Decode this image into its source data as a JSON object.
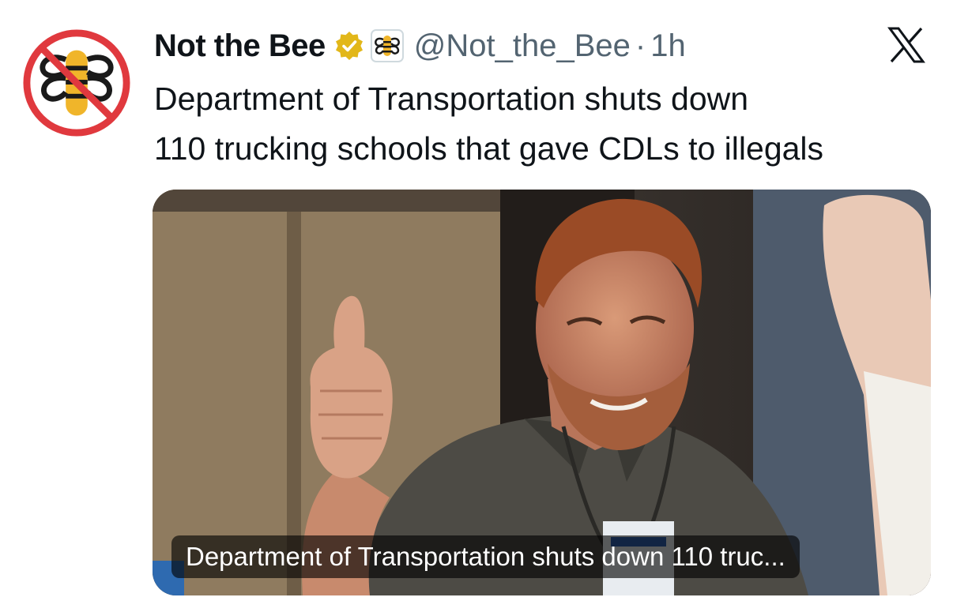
{
  "tweet": {
    "display_name": "Not the Bee",
    "handle": "@Not_the_Bee",
    "separator": "·",
    "time": "1h",
    "text_line1": "Department of Transportation shuts down",
    "text_line2": "110 trucking schools that gave CDLs to illegals",
    "verified": true
  },
  "media": {
    "caption": "Department of Transportation shuts down 110 truc..."
  },
  "icons": {
    "avatar": "not-the-bee-logo",
    "verified": "gold-verified-badge",
    "affiliate": "bee-affiliate-badge",
    "platform": "x-logo"
  },
  "colors": {
    "verified_gold": "#e2b719",
    "logo_red": "#e0393e",
    "logo_bee": "#f0b52a",
    "handle_gray": "#536471"
  }
}
